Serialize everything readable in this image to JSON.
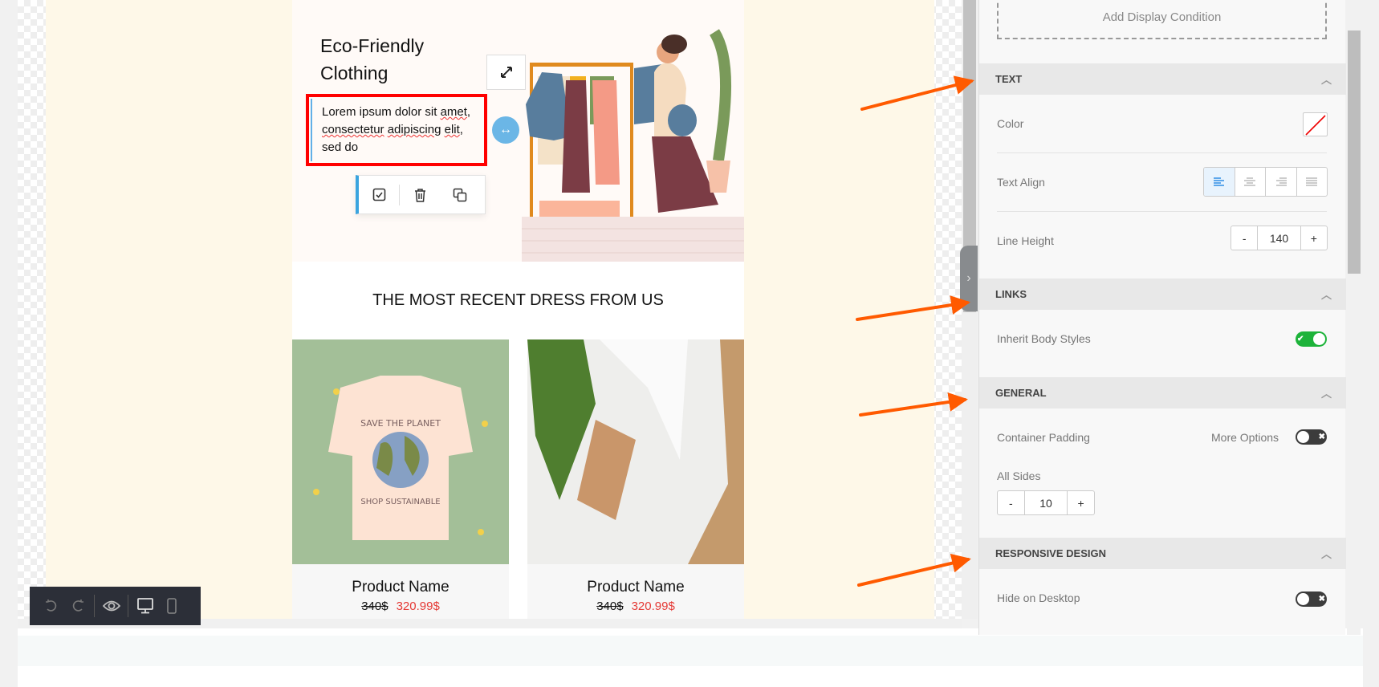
{
  "email": {
    "hero_title": "Eco-Friendly Clothing",
    "hero_text_parts": [
      "Lorem ipsum dolor sit ",
      "amet",
      ",",
      "consectetur",
      " ",
      "adipiscing",
      " ",
      "elit",
      ",",
      "sed do"
    ],
    "section_title": "THE MOST RECENT DRESS FROM US",
    "products": [
      {
        "name": "Product Name",
        "old_price": "340$",
        "price": "320.99$",
        "image_text": [
          "SAVE THE PLANET",
          "SHOP SUSTAINABLE"
        ]
      },
      {
        "name": "Product Name",
        "old_price": "340$",
        "price": "320.99$"
      }
    ],
    "element_toolbar": {
      "icons": [
        "checkbox-icon",
        "trash-icon",
        "duplicate-icon"
      ]
    }
  },
  "panel": {
    "add_display_condition": "Add Display Condition",
    "text_section": {
      "title": "TEXT",
      "color_label": "Color",
      "text_align_label": "Text Align",
      "text_align_selected": "left",
      "line_height_label": "Line Height",
      "line_height_value": "140"
    },
    "links_section": {
      "title": "LINKS",
      "inherit_label": "Inherit Body Styles",
      "inherit_on": true
    },
    "general_section": {
      "title": "GENERAL",
      "container_padding_label": "Container Padding",
      "more_options_label": "More Options",
      "more_options_on": false,
      "all_sides_label": "All Sides",
      "all_sides_value": "10"
    },
    "responsive_section": {
      "title": "RESPONSIVE DESIGN",
      "hide_desktop_label": "Hide on Desktop",
      "hide_desktop_on": false
    },
    "stepper_minus": "-",
    "stepper_plus": "+"
  },
  "colors": {
    "annotation_arrow": "#ff5a00",
    "highlight_box": "#ff0000",
    "toggle_on": "#1db33a",
    "accent": "#3a95e8",
    "sale_price": "#e53935"
  }
}
